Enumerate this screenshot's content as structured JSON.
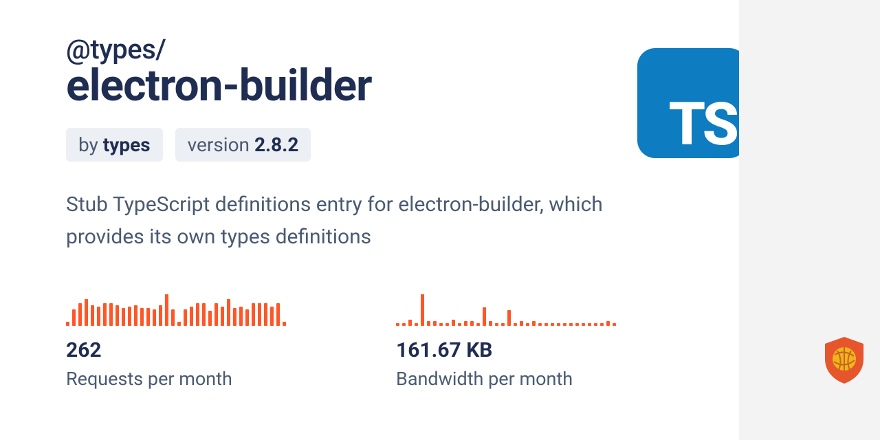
{
  "package": {
    "scope": "@types/",
    "name": "electron-builder",
    "author_prefix": "by ",
    "author": "types",
    "version_prefix": "version ",
    "version": "2.8.2",
    "description": "Stub TypeScript definitions entry for electron-builder, which provides its own types definitions",
    "logo_text": "TS"
  },
  "stats": {
    "requests": {
      "value": "262",
      "label": "Requests per month"
    },
    "bandwidth": {
      "value": "161.67 KB",
      "label": "Bandwidth per month"
    }
  },
  "chart_data": [
    {
      "type": "bar",
      "title": "Requests per month sparkline",
      "values": [
        6,
        22,
        30,
        36,
        28,
        26,
        30,
        30,
        28,
        24,
        26,
        28,
        24,
        24,
        22,
        28,
        42,
        22,
        6,
        22,
        26,
        30,
        30,
        20,
        30,
        26,
        36,
        24,
        26,
        22,
        30,
        30,
        30,
        26,
        30,
        6
      ]
    },
    {
      "type": "bar",
      "title": "Bandwidth per month sparkline",
      "values": [
        4,
        4,
        8,
        4,
        40,
        6,
        6,
        4,
        4,
        8,
        4,
        6,
        6,
        4,
        24,
        6,
        4,
        4,
        20,
        4,
        6,
        4,
        6,
        4,
        4,
        4,
        4,
        4,
        4,
        4,
        4,
        4,
        4,
        4,
        6,
        4
      ]
    }
  ],
  "colors": {
    "accent": "#ff5627",
    "ts": "#0d7cc1",
    "shield": "#e7552c",
    "shield_inner": "#f0b51e"
  }
}
